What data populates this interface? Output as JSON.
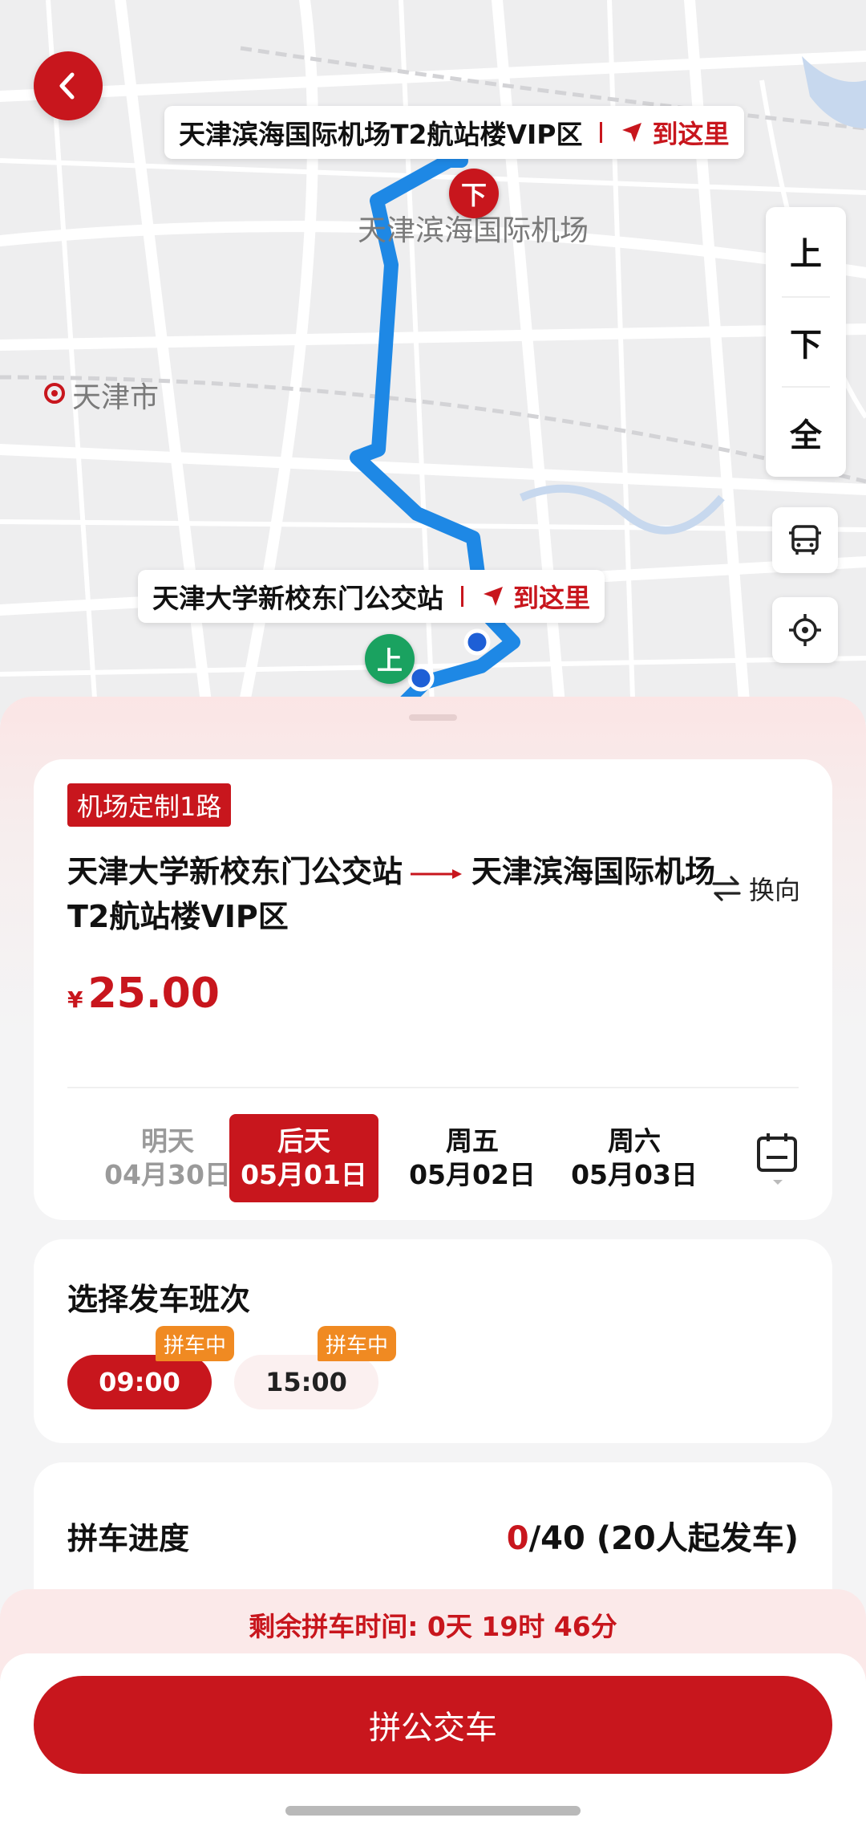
{
  "map": {
    "dropoff_callout": {
      "name": "天津滨海国际机场T2航站楼VIP区",
      "action": "到这里"
    },
    "pickup_callout": {
      "name": "天津大学新校东门公交站",
      "action": "到这里"
    },
    "city_label": "天津市",
    "airport_label": "天津滨海国际机场",
    "pin_down_label": "下",
    "pin_up_label": "上",
    "zoom": {
      "up": "上",
      "down": "下",
      "all": "全"
    },
    "icons": [
      "back-icon",
      "bus-icon",
      "locate-icon",
      "navigation-arrow-icon"
    ]
  },
  "route_card": {
    "tag": "机场定制1路",
    "from": "天津大学新校东门公交站",
    "to": "天津滨海国际机场T2航站楼VIP区",
    "switch_label": "换向",
    "currency": "¥",
    "price": "25.00",
    "dates": [
      {
        "day": "明天",
        "date": "04月30日",
        "state": "disabled"
      },
      {
        "day": "后天",
        "date": "05月01日",
        "state": "selected"
      },
      {
        "day": "周五",
        "date": "05月02日",
        "state": "normal"
      },
      {
        "day": "周六",
        "date": "05月03日",
        "state": "normal"
      }
    ]
  },
  "schedule": {
    "title": "选择发车班次",
    "times": [
      {
        "time": "09:00",
        "badge": "拼车中",
        "selected": true
      },
      {
        "time": "15:00",
        "badge": "拼车中",
        "selected": false
      }
    ]
  },
  "progress": {
    "title": "拼车进度",
    "current": "0",
    "rest": "/40 (20人起发车)"
  },
  "remaining": "剩余拼车时间: 0天 19时 46分",
  "cta_label": "拼公交车",
  "colors": {
    "brand": "#c8161d",
    "route": "#1e88e5",
    "badge": "#f08a22",
    "pickup": "#1aa260"
  }
}
